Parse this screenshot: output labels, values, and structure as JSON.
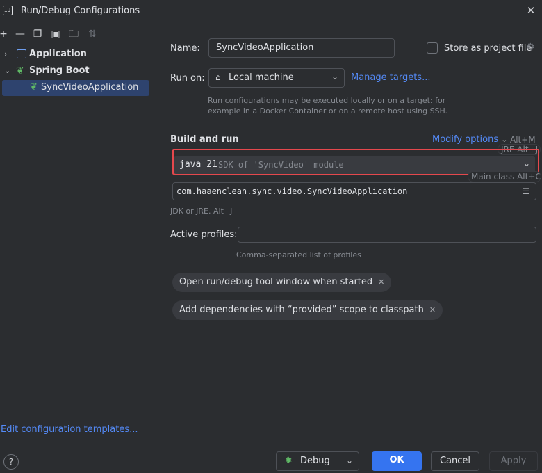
{
  "window": {
    "title": "Run/Debug Configurations",
    "app_icon": "IJ"
  },
  "toolbar": {
    "icons": [
      "add-icon",
      "remove-icon",
      "copy-icon",
      "save-icon",
      "new-folder-icon",
      "sort-icon"
    ]
  },
  "tree": {
    "items": [
      {
        "label": "Application",
        "expanded": false
      },
      {
        "label": "Spring Boot",
        "expanded": true
      },
      {
        "label": "SyncVideoApplication",
        "selected": true
      }
    ]
  },
  "edit_templates": "Edit configuration templates...",
  "form": {
    "name_label": "Name:",
    "name_value": "SyncVideoApplication",
    "store_label": "Store as project file",
    "runon_label": "Run on:",
    "runon_value": "Local machine",
    "manage_targets": "Manage targets...",
    "runon_hint_1": "Run configurations may be executed locally or on a target: for",
    "runon_hint_2": "example in a Docker Container or on a remote host using SSH.",
    "build_title": "Build and run",
    "modify_options": "Modify options",
    "modify_shortcut": "Alt+M",
    "jre_hint": "JRE Alt+J",
    "jdk_main": "java 21",
    "jdk_sub": "SDK of 'SyncVideo' module",
    "main_class_hint": "Main class Alt+C",
    "main_class": "com.haaenclean.sync.video.SyncVideoApplication",
    "jdk_hint": "JDK or JRE. Alt+J",
    "profiles_label": "Active profiles:",
    "profiles_value": "",
    "profiles_hint": "Comma-separated list of profiles",
    "chips": [
      "Open run/debug tool window when started",
      "Add dependencies with “provided” scope to classpath"
    ]
  },
  "footer": {
    "help": "?",
    "debug": "Debug",
    "ok": "OK",
    "cancel": "Cancel",
    "apply": "Apply"
  },
  "colors": {
    "accent": "#3574f0",
    "highlight_border": "#e5484d",
    "link": "#548af7",
    "selection": "#2e436e"
  }
}
